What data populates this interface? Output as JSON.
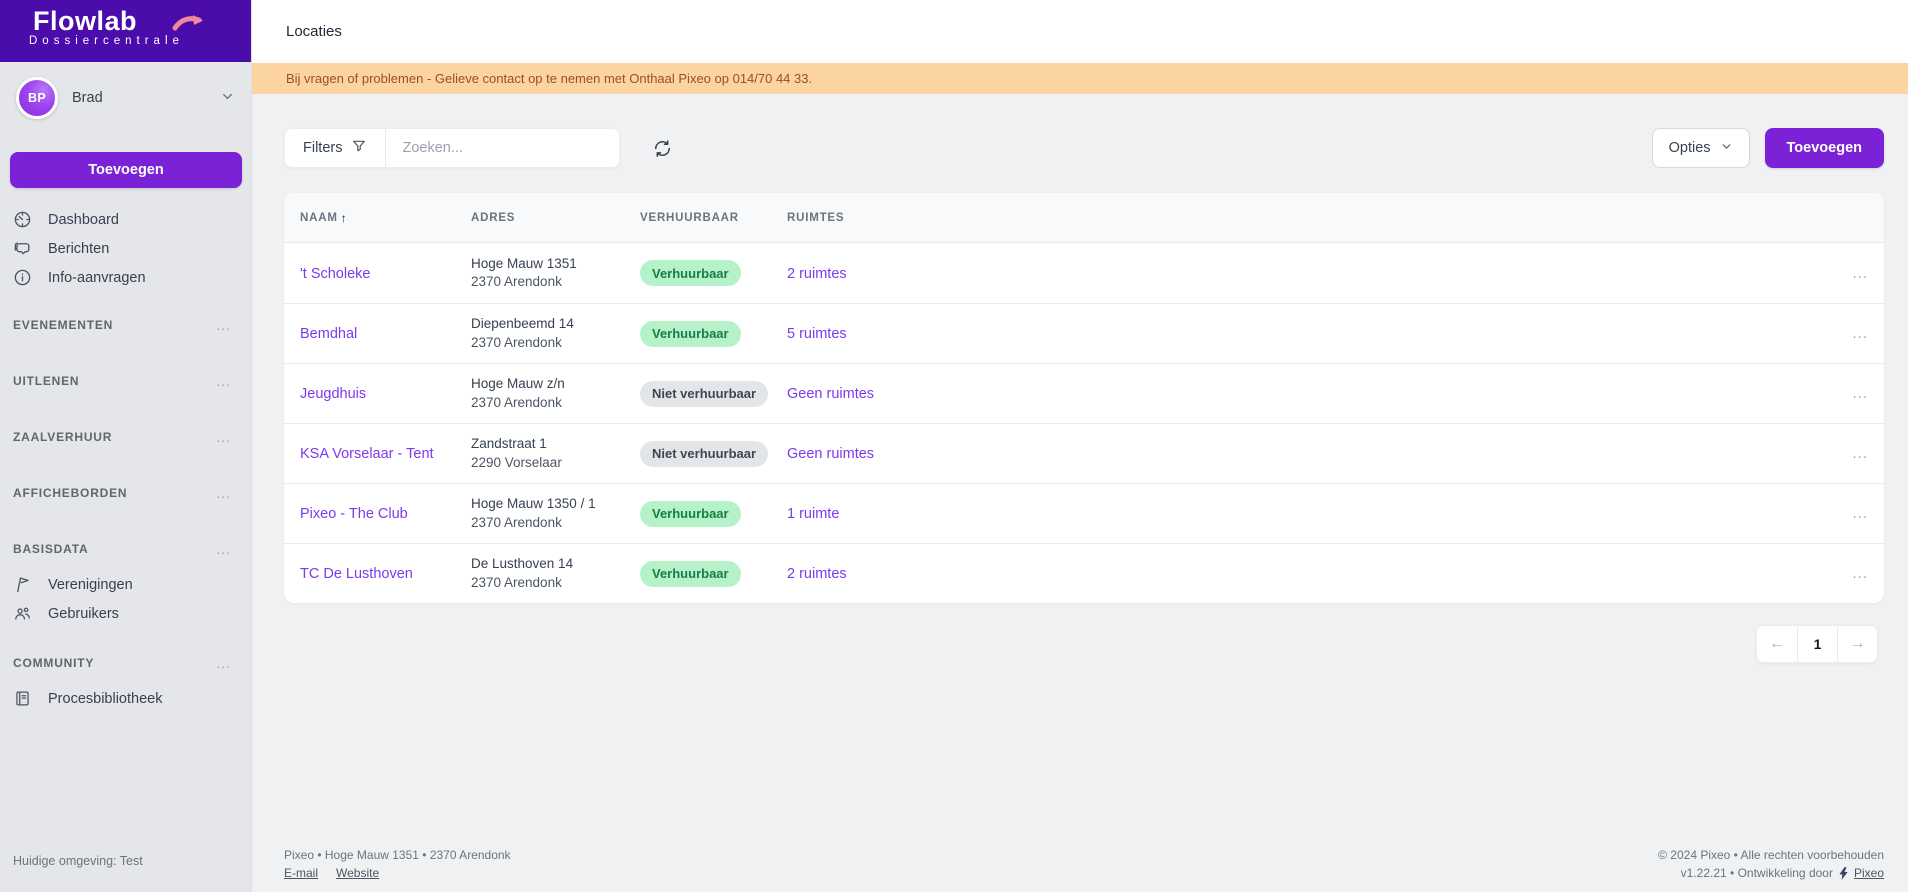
{
  "colors": {
    "sidebar_header_purple": "#4A0CAB",
    "accent_purple": "#7C22D6",
    "link_purple": "#7C3AED",
    "logo_arrow_pink": "#F0899C",
    "banner_bg": "#FBD4A2",
    "banner_text": "#9F4E20",
    "status_positive_bg": "#B5F2CA",
    "status_positive_text": "#187D44",
    "status_neutral_bg": "#E4E5E9",
    "status_neutral_text": "#3D4654"
  },
  "icons": {
    "sort_ascending": "↑",
    "row_actions": "...",
    "section_more": "...",
    "page_prev": "←",
    "page_next": "→"
  },
  "sidebar": {
    "logo": {
      "title": "Flowlab",
      "subtitle": "Dossiercentrale"
    },
    "user": {
      "initials": "BP",
      "name": "Brad"
    },
    "add_button": "Toevoegen",
    "nav": [
      {
        "label": "Dashboard"
      },
      {
        "label": "Berichten"
      },
      {
        "label": "Info-aanvragen"
      }
    ],
    "sections": [
      {
        "label": "EVENEMENTEN"
      },
      {
        "label": "UITLENEN"
      },
      {
        "label": "ZAALVERHUUR"
      },
      {
        "label": "AFFICHEBORDEN"
      },
      {
        "label": "BASISDATA",
        "items": [
          {
            "label": "Verenigingen"
          },
          {
            "label": "Gebruikers"
          }
        ]
      },
      {
        "label": "COMMUNITY",
        "items": [
          {
            "label": "Procesbibliotheek"
          }
        ]
      }
    ],
    "environment": "Huidige omgeving: Test"
  },
  "header": {
    "title": "Locaties"
  },
  "banner": {
    "text": "Bij vragen of problemen - Gelieve contact op te nemen met Onthaal Pixeo op 014/70 44 33."
  },
  "toolbar": {
    "filters_label": "Filters",
    "search_placeholder": "Zoeken...",
    "options_label": "Opties",
    "add_label": "Toevoegen"
  },
  "table": {
    "columns": {
      "name": "Naam",
      "address": "Adres",
      "rentable": "Verhuurbaar",
      "rooms": "Ruimtes"
    },
    "rows": [
      {
        "name": "'t Scholeke",
        "address_line1": "Hoge Mauw 1351",
        "address_line2": "2370 Arendonk",
        "status": "Verhuurbaar",
        "status_type": "positive",
        "rooms": "2 ruimtes"
      },
      {
        "name": "Bemdhal",
        "address_line1": "Diepenbeemd 14",
        "address_line2": "2370 Arendonk",
        "status": "Verhuurbaar",
        "status_type": "positive",
        "rooms": "5 ruimtes"
      },
      {
        "name": "Jeugdhuis",
        "address_line1": "Hoge Mauw z/n",
        "address_line2": "2370 Arendonk",
        "status": "Niet verhuurbaar",
        "status_type": "neutral",
        "rooms": "Geen ruimtes"
      },
      {
        "name": "KSA Vorselaar - Tent",
        "address_line1": "Zandstraat 1",
        "address_line2": "2290 Vorselaar",
        "status": "Niet verhuurbaar",
        "status_type": "neutral",
        "rooms": "Geen ruimtes"
      },
      {
        "name": "Pixeo - The Club",
        "address_line1": "Hoge Mauw 1350 / 1",
        "address_line2": "2370 Arendonk",
        "status": "Verhuurbaar",
        "status_type": "positive",
        "rooms": "1 ruimte"
      },
      {
        "name": "TC De Lusthoven",
        "address_line1": "De Lusthoven 14",
        "address_line2": "2370 Arendonk",
        "status": "Verhuurbaar",
        "status_type": "positive",
        "rooms": "2 ruimtes"
      }
    ]
  },
  "pagination": {
    "current_page": "1"
  },
  "footer": {
    "address_line": "Pixeo • Hoge Mauw 1351 • 2370 Arendonk",
    "email_link": "E-mail",
    "website_link": "Website",
    "copyright_line": "© 2024 Pixeo • Alle rechten voorbehouden",
    "version_line": "v1.22.21 • Ontwikkeling door",
    "vendor_link": "Pixeo"
  }
}
